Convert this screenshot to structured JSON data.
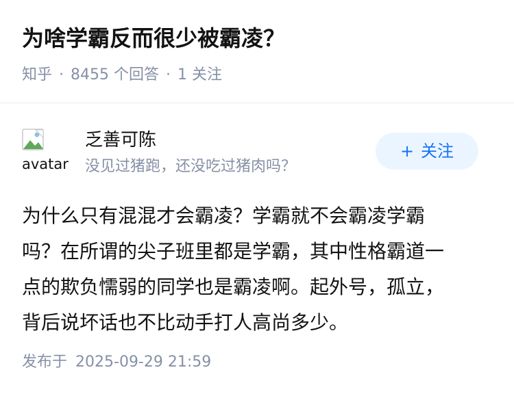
{
  "question": {
    "title": "为啥学霸反而很少被霸凌？",
    "meta": {
      "source": "知乎",
      "separator": "·",
      "answers": "8455 个回答",
      "followers": "1 关注"
    }
  },
  "answer": {
    "author": {
      "avatar_alt": "avatar",
      "name": "乏善可陈",
      "bio": "没见过猪跑，还没吃过猪肉吗？"
    },
    "follow_button": {
      "icon": "+",
      "label": "关注"
    },
    "content_lines": [
      "为什么只有混混才会霸凌？学霸就不会霸凌学霸",
      "吗？在所谓的尖子班里都是学霸，其中性格霸道一",
      "点的欺负懦弱的同学也是霸凌啊。起外号，孤立，",
      "背后说坏话也不比动手打人高尚多少。"
    ],
    "published_label": "发布于",
    "published_time": "2025-09-29 21:59"
  },
  "colors": {
    "primary": "#1772f6",
    "button_bg": "#ebf5ff",
    "muted": "#8590a6",
    "text": "#121212"
  }
}
